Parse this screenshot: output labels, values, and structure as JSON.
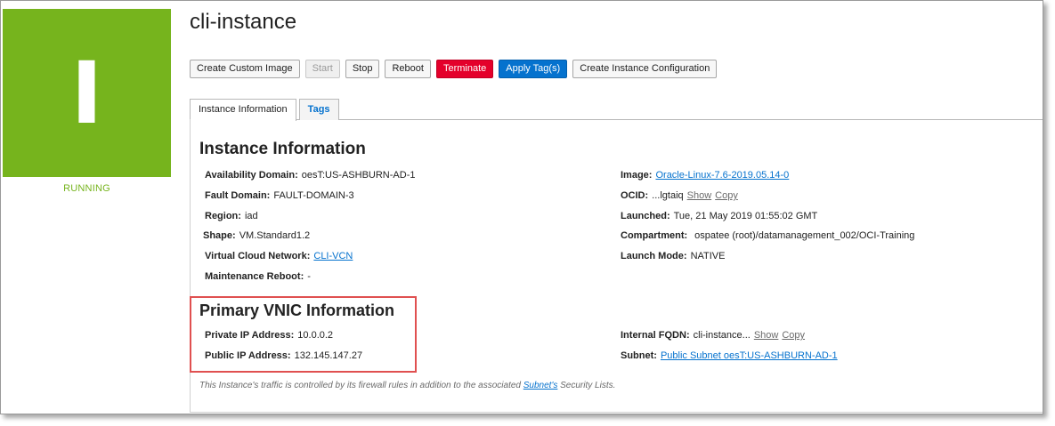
{
  "instance": {
    "name": "cli-instance",
    "status": "RUNNING",
    "letter": "I"
  },
  "toolbar": {
    "create_custom_image": "Create Custom Image",
    "start": "Start",
    "stop": "Stop",
    "reboot": "Reboot",
    "terminate": "Terminate",
    "apply_tags": "Apply Tag(s)",
    "create_instance_configuration": "Create Instance Configuration"
  },
  "tabs": {
    "instance_information": "Instance Information",
    "tags": "Tags"
  },
  "instance_info": {
    "title": "Instance Information",
    "availability_domain": {
      "label": "Availability Domain:",
      "value": "oesT:US-ASHBURN-AD-1"
    },
    "fault_domain": {
      "label": "Fault Domain:",
      "value": "FAULT-DOMAIN-3"
    },
    "region": {
      "label": "Region:",
      "value": "iad"
    },
    "shape": {
      "label": "Shape:",
      "value": "VM.Standard1.2"
    },
    "vcn": {
      "label": "Virtual Cloud Network:",
      "value": "CLI-VCN"
    },
    "maintenance_reboot": {
      "label": "Maintenance Reboot:",
      "value": "-"
    },
    "image": {
      "label": "Image:",
      "value": "Oracle-Linux-7.6-2019.05.14-0"
    },
    "ocid": {
      "label": "OCID:",
      "value": "...lgtaiq",
      "show": "Show",
      "copy": "Copy"
    },
    "launched": {
      "label": "Launched:",
      "value": "Tue, 21 May 2019 01:55:02 GMT"
    },
    "compartment": {
      "label": "Compartment:",
      "value": "ospatee (root)/datamanagement_002/OCI-Training"
    },
    "launch_mode": {
      "label": "Launch Mode:",
      "value": "NATIVE"
    }
  },
  "vnic_info": {
    "title": "Primary VNIC Information",
    "private_ip": {
      "label": "Private IP Address:",
      "value": "10.0.0.2"
    },
    "public_ip": {
      "label": "Public IP Address:",
      "value": "132.145.147.27"
    },
    "internal_fqdn": {
      "label": "Internal FQDN:",
      "value": "cli-instance...",
      "show": "Show",
      "copy": "Copy"
    },
    "subnet": {
      "label": "Subnet:",
      "value": "Public Subnet oesT:US-ASHBURN-AD-1"
    }
  },
  "footnote": {
    "prefix": "This Instance's traffic is controlled by its firewall rules in addition to the associated ",
    "link": "Subnet's",
    "suffix": " Security Lists."
  },
  "colors": {
    "status_green": "#76b41d",
    "danger_red": "#e4002b",
    "primary_blue": "#0572ce",
    "highlight_red": "#e05050"
  }
}
